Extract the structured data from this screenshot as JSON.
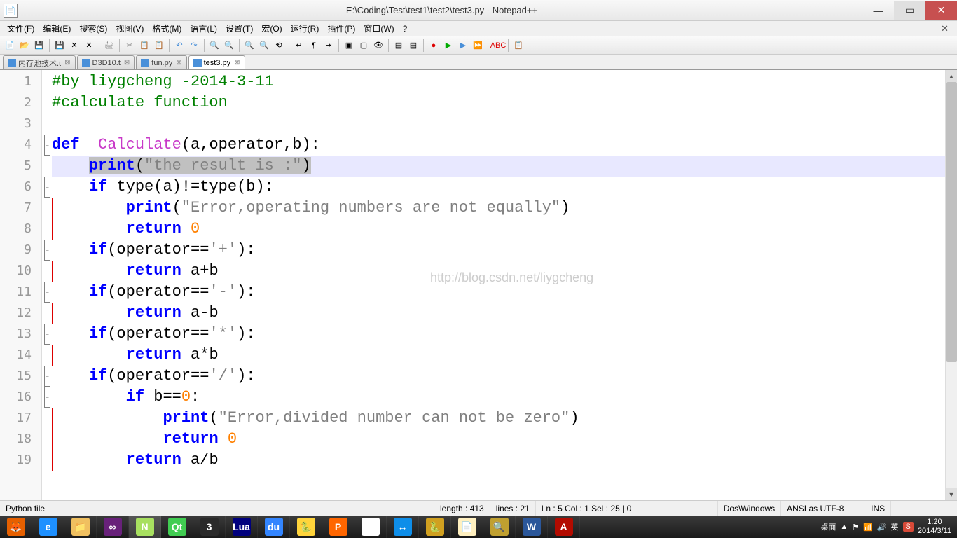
{
  "title": "E:\\Coding\\Test\\test1\\test2\\test3.py - Notepad++",
  "menu": [
    "文件(F)",
    "编辑(E)",
    "搜索(S)",
    "视图(V)",
    "格式(M)",
    "语言(L)",
    "设置(T)",
    "宏(O)",
    "运行(R)",
    "插件(P)",
    "窗口(W)",
    "?"
  ],
  "tabs": [
    {
      "label": "内存池技术.t",
      "active": false
    },
    {
      "label": "D3D10.t",
      "active": false
    },
    {
      "label": "fun.py",
      "active": false
    },
    {
      "label": "test3.py",
      "active": true
    }
  ],
  "code": {
    "lines": [
      {
        "n": 1,
        "fold": "",
        "seg": [
          {
            "t": "#by liygcheng -2014-3-11",
            "c": "c-comment"
          }
        ]
      },
      {
        "n": 2,
        "fold": "",
        "seg": [
          {
            "t": "#calculate function",
            "c": "c-comment"
          }
        ]
      },
      {
        "n": 3,
        "fold": "",
        "seg": [
          {
            "t": "",
            "c": ""
          }
        ]
      },
      {
        "n": 4,
        "fold": "minus",
        "seg": [
          {
            "t": "def",
            "c": "c-kw"
          },
          {
            "t": "  ",
            "c": ""
          },
          {
            "t": "Calculate",
            "c": "c-fn"
          },
          {
            "t": "(",
            "c": "c-op"
          },
          {
            "t": "a",
            "c": "c-name"
          },
          {
            "t": ",",
            "c": "c-op"
          },
          {
            "t": "operator",
            "c": "c-name"
          },
          {
            "t": ",",
            "c": "c-op"
          },
          {
            "t": "b",
            "c": "c-name"
          },
          {
            "t": "):",
            "c": "c-op"
          }
        ]
      },
      {
        "n": 5,
        "fold": "line",
        "hl": true,
        "seg": [
          {
            "t": "    ",
            "c": ""
          },
          {
            "t": "print",
            "c": "c-kw",
            "sel": true
          },
          {
            "t": "(",
            "c": "c-op",
            "sel": true
          },
          {
            "t": "\"the result is :\"",
            "c": "c-str",
            "sel": true
          },
          {
            "t": ")",
            "c": "c-op",
            "sel": true
          }
        ]
      },
      {
        "n": 6,
        "fold": "minus",
        "seg": [
          {
            "t": "    ",
            "c": ""
          },
          {
            "t": "if",
            "c": "c-kw"
          },
          {
            "t": " type",
            "c": "c-name"
          },
          {
            "t": "(",
            "c": "c-op"
          },
          {
            "t": "a",
            "c": "c-name"
          },
          {
            "t": ")!=",
            "c": "c-op"
          },
          {
            "t": "type",
            "c": "c-name"
          },
          {
            "t": "(",
            "c": "c-op"
          },
          {
            "t": "b",
            "c": "c-name"
          },
          {
            "t": "):",
            "c": "c-op"
          }
        ]
      },
      {
        "n": 7,
        "fold": "line",
        "seg": [
          {
            "t": "        ",
            "c": ""
          },
          {
            "t": "print",
            "c": "c-kw"
          },
          {
            "t": "(",
            "c": "c-op"
          },
          {
            "t": "\"Error,operating numbers are not equally\"",
            "c": "c-str"
          },
          {
            "t": ")",
            "c": "c-op"
          }
        ]
      },
      {
        "n": 8,
        "fold": "line",
        "seg": [
          {
            "t": "        ",
            "c": ""
          },
          {
            "t": "return",
            "c": "c-kw"
          },
          {
            "t": " ",
            "c": ""
          },
          {
            "t": "0",
            "c": "c-num"
          }
        ]
      },
      {
        "n": 9,
        "fold": "minus",
        "seg": [
          {
            "t": "    ",
            "c": ""
          },
          {
            "t": "if",
            "c": "c-kw"
          },
          {
            "t": "(",
            "c": "c-op"
          },
          {
            "t": "operator",
            "c": "c-name"
          },
          {
            "t": "==",
            "c": "c-op"
          },
          {
            "t": "'+'",
            "c": "c-str"
          },
          {
            "t": "):",
            "c": "c-op"
          }
        ]
      },
      {
        "n": 10,
        "fold": "line",
        "seg": [
          {
            "t": "        ",
            "c": ""
          },
          {
            "t": "return",
            "c": "c-kw"
          },
          {
            "t": " a",
            "c": "c-name"
          },
          {
            "t": "+",
            "c": "c-op"
          },
          {
            "t": "b",
            "c": "c-name"
          }
        ]
      },
      {
        "n": 11,
        "fold": "minus",
        "seg": [
          {
            "t": "    ",
            "c": ""
          },
          {
            "t": "if",
            "c": "c-kw"
          },
          {
            "t": "(",
            "c": "c-op"
          },
          {
            "t": "operator",
            "c": "c-name"
          },
          {
            "t": "==",
            "c": "c-op"
          },
          {
            "t": "'-'",
            "c": "c-str"
          },
          {
            "t": "):",
            "c": "c-op"
          }
        ]
      },
      {
        "n": 12,
        "fold": "line",
        "seg": [
          {
            "t": "        ",
            "c": ""
          },
          {
            "t": "return",
            "c": "c-kw"
          },
          {
            "t": " a",
            "c": "c-name"
          },
          {
            "t": "-",
            "c": "c-op"
          },
          {
            "t": "b",
            "c": "c-name"
          }
        ]
      },
      {
        "n": 13,
        "fold": "minus",
        "seg": [
          {
            "t": "    ",
            "c": ""
          },
          {
            "t": "if",
            "c": "c-kw"
          },
          {
            "t": "(",
            "c": "c-op"
          },
          {
            "t": "operator",
            "c": "c-name"
          },
          {
            "t": "==",
            "c": "c-op"
          },
          {
            "t": "'*'",
            "c": "c-str"
          },
          {
            "t": "):",
            "c": "c-op"
          }
        ]
      },
      {
        "n": 14,
        "fold": "line",
        "seg": [
          {
            "t": "        ",
            "c": ""
          },
          {
            "t": "return",
            "c": "c-kw"
          },
          {
            "t": " a",
            "c": "c-name"
          },
          {
            "t": "*",
            "c": "c-op"
          },
          {
            "t": "b",
            "c": "c-name"
          }
        ]
      },
      {
        "n": 15,
        "fold": "minus",
        "seg": [
          {
            "t": "    ",
            "c": ""
          },
          {
            "t": "if",
            "c": "c-kw"
          },
          {
            "t": "(",
            "c": "c-op"
          },
          {
            "t": "operator",
            "c": "c-name"
          },
          {
            "t": "==",
            "c": "c-op"
          },
          {
            "t": "'/'",
            "c": "c-str"
          },
          {
            "t": "):",
            "c": "c-op"
          }
        ]
      },
      {
        "n": 16,
        "fold": "minus",
        "seg": [
          {
            "t": "        ",
            "c": ""
          },
          {
            "t": "if",
            "c": "c-kw"
          },
          {
            "t": " b",
            "c": "c-name"
          },
          {
            "t": "==",
            "c": "c-op"
          },
          {
            "t": "0",
            "c": "c-num"
          },
          {
            "t": ":",
            "c": "c-op"
          }
        ]
      },
      {
        "n": 17,
        "fold": "line",
        "seg": [
          {
            "t": "            ",
            "c": ""
          },
          {
            "t": "print",
            "c": "c-kw"
          },
          {
            "t": "(",
            "c": "c-op"
          },
          {
            "t": "\"Error,divided number can not be zero\"",
            "c": "c-str"
          },
          {
            "t": ")",
            "c": "c-op"
          }
        ]
      },
      {
        "n": 18,
        "fold": "line",
        "seg": [
          {
            "t": "            ",
            "c": ""
          },
          {
            "t": "return",
            "c": "c-kw"
          },
          {
            "t": " ",
            "c": ""
          },
          {
            "t": "0",
            "c": "c-num"
          }
        ]
      },
      {
        "n": 19,
        "fold": "line",
        "seg": [
          {
            "t": "        ",
            "c": ""
          },
          {
            "t": "return",
            "c": "c-kw"
          },
          {
            "t": " a",
            "c": "c-name"
          },
          {
            "t": "/",
            "c": "c-op"
          },
          {
            "t": "b",
            "c": "c-name"
          }
        ]
      }
    ]
  },
  "watermark": "http://blog.csdn.net/liygcheng",
  "status": {
    "filetype": "Python file",
    "length": "length : 413",
    "lines": "lines : 21",
    "pos": "Ln : 5   Col : 1   Sel : 25 | 0",
    "eol": "Dos\\Windows",
    "enc": "ANSI as UTF-8",
    "ins": "INS"
  },
  "tray": {
    "desktop": "桌面",
    "ime": "英",
    "time": "1:20",
    "date": "2014/3/11"
  },
  "toolbar_icons": [
    "new",
    "open",
    "save",
    "save-all",
    "close",
    "close-all",
    "print",
    "cut",
    "copy",
    "paste",
    "undo",
    "redo",
    "find",
    "replace",
    "zoom-in",
    "zoom-out",
    "sync",
    "wrap",
    "show-all",
    "indent",
    "fold",
    "unfold",
    "hidden",
    "comment",
    "uncomment",
    "record",
    "play",
    "play2",
    "play-all",
    "spell",
    "doc"
  ],
  "taskbar_apps": [
    {
      "name": "firefox",
      "bg": "#e66000",
      "txt": "🦊"
    },
    {
      "name": "ie",
      "bg": "#1e90ff",
      "txt": "e"
    },
    {
      "name": "explorer",
      "bg": "#f0c060",
      "txt": "📁"
    },
    {
      "name": "vs",
      "bg": "#68217a",
      "txt": "∞"
    },
    {
      "name": "notepadpp",
      "bg": "#a8e060",
      "txt": "N",
      "active": true
    },
    {
      "name": "qt",
      "bg": "#41cd52",
      "txt": "Qt"
    },
    {
      "name": "3ds",
      "bg": "#2a2a2a",
      "txt": "3"
    },
    {
      "name": "lua",
      "bg": "#00007d",
      "txt": "Lua"
    },
    {
      "name": "baidu",
      "bg": "#3385ff",
      "txt": "du"
    },
    {
      "name": "python",
      "bg": "#ffd43b",
      "txt": "🐍"
    },
    {
      "name": "p",
      "bg": "#ff6600",
      "txt": "P"
    },
    {
      "name": "chrome",
      "bg": "#fff",
      "txt": "◉"
    },
    {
      "name": "teamviewer",
      "bg": "#0e8ee9",
      "txt": "↔"
    },
    {
      "name": "pycharm",
      "bg": "#d0a020",
      "txt": "🐍"
    },
    {
      "name": "notepad",
      "bg": "#fff0c0",
      "txt": "📄"
    },
    {
      "name": "search",
      "bg": "#c0a030",
      "txt": "🔍"
    },
    {
      "name": "word",
      "bg": "#2b579a",
      "txt": "W"
    },
    {
      "name": "acrobat",
      "bg": "#b30b00",
      "txt": "A"
    }
  ]
}
